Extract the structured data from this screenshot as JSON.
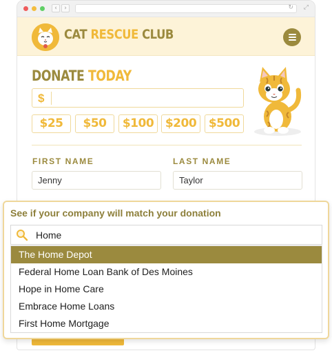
{
  "brand": {
    "name_part1": "CAT ",
    "name_part2": "RESCUE",
    "name_part3": " CLUB",
    "logo_icon": "cat-face-icon"
  },
  "donate": {
    "title_part1": "DONATE ",
    "title_part2": "TODAY",
    "currency_symbol": "$",
    "amount_value": "",
    "presets": [
      "$25",
      "$50",
      "$100",
      "$200",
      "$500"
    ]
  },
  "form": {
    "first_name_label": "FIRST NAME",
    "first_name_value": "Jenny",
    "last_name_label": "LAST NAME",
    "last_name_value": "Taylor"
  },
  "match": {
    "title": "See if your company will match your donation",
    "search_value": "Home",
    "results": [
      "The Home Depot",
      "Federal Home Loan Bank of Des Moines",
      "Hope in Home Care",
      "Embrace Home Loans",
      "First Home Mortgage"
    ],
    "selected_index": 0
  },
  "colors": {
    "olive": "#9b8a3e",
    "gold": "#f0b93a",
    "header_bg": "#fdf3d8"
  },
  "icons": [
    "search-icon",
    "menu-icon",
    "reload-icon",
    "expand-icon",
    "back-icon",
    "forward-icon"
  ]
}
